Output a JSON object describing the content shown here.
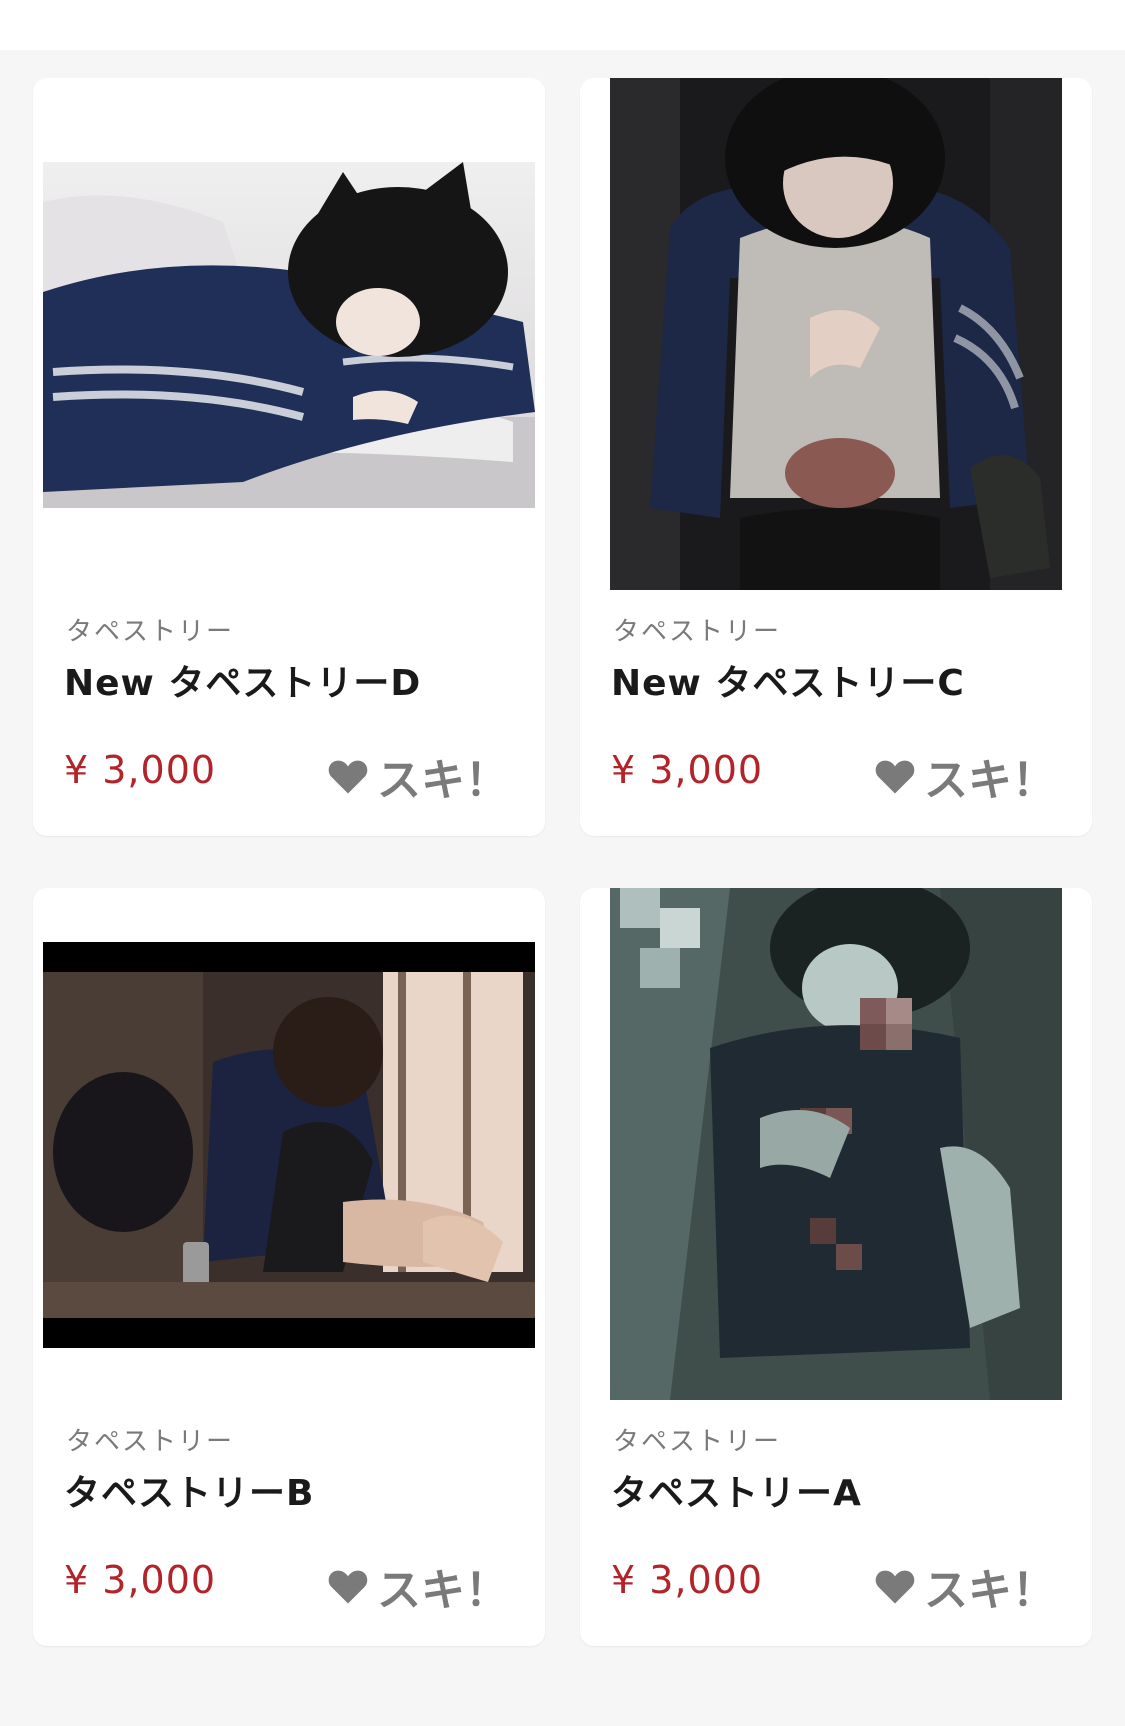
{
  "products": [
    {
      "category": "タペストリー",
      "title": "New タペストリーD",
      "price": "¥ 3,000",
      "like_label": "スキ！",
      "image": "artwork-boy-lying-on-bed"
    },
    {
      "category": "タペストリー",
      "title": "New タペストリーC",
      "price": "¥ 3,000",
      "like_label": "スキ！",
      "image": "artwork-boy-dark-jacket-standing"
    },
    {
      "category": "タペストリー",
      "title": "タペストリーB",
      "price": "¥ 3,000",
      "like_label": "スキ！",
      "image": "artwork-boy-sitting-by-window"
    },
    {
      "category": "タペストリー",
      "title": "タペストリーA",
      "price": "¥ 3,000",
      "like_label": "スキ！",
      "image": "artwork-boy-dark-pixelated"
    }
  ],
  "colors": {
    "price": "#b3232a",
    "like": "#7a7a7a",
    "background": "#f6f6f6"
  },
  "icons": {
    "like": "heart-icon"
  }
}
